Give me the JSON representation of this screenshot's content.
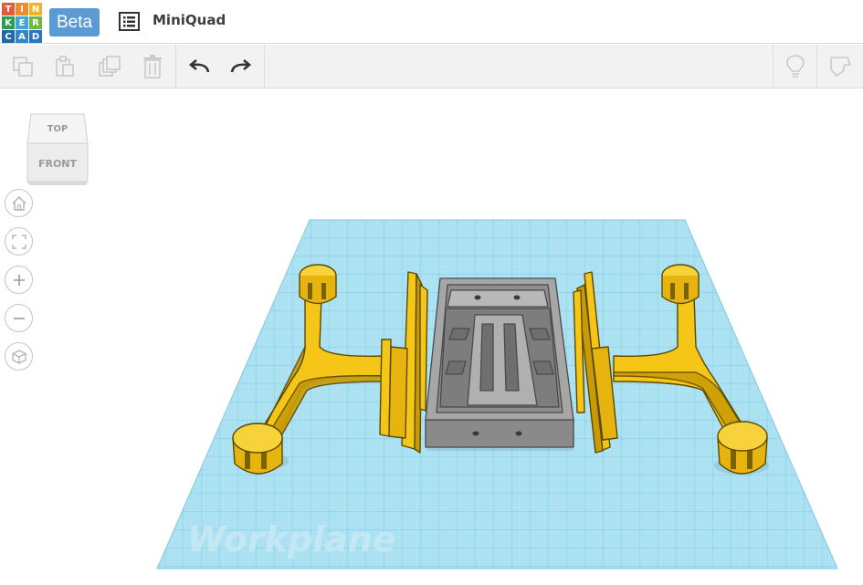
{
  "app": {
    "logo_letters": [
      "T",
      "I",
      "N",
      "K",
      "E",
      "R",
      "C",
      "A",
      "D"
    ],
    "logo_colors": [
      "#e25b3b",
      "#ee8d2c",
      "#f0b429",
      "#2f9e55",
      "#3fa6d9",
      "#6fb83d",
      "#1f6aa6",
      "#2f86c9",
      "#2b74bf"
    ],
    "badge": "Beta",
    "document_title": "MiniQuad"
  },
  "toolbar": {
    "copy": "copy-icon",
    "paste": "paste-icon",
    "duplicate": "duplicate-icon",
    "delete": "trash-icon",
    "undo": "undo-icon",
    "redo": "redo-icon",
    "hint": "lightbulb-icon",
    "notes": "note-icon"
  },
  "viewcube": {
    "top": "TOP",
    "front": "FRONT"
  },
  "navigation": [
    "home-view",
    "fit-view",
    "zoom-in",
    "zoom-out",
    "orthographic-view"
  ],
  "workplane": {
    "label": "Workplane",
    "color": "#9fdcf0"
  },
  "scene": {
    "arm_color": "#f5c518",
    "frame_color": "#8e8e8e"
  }
}
